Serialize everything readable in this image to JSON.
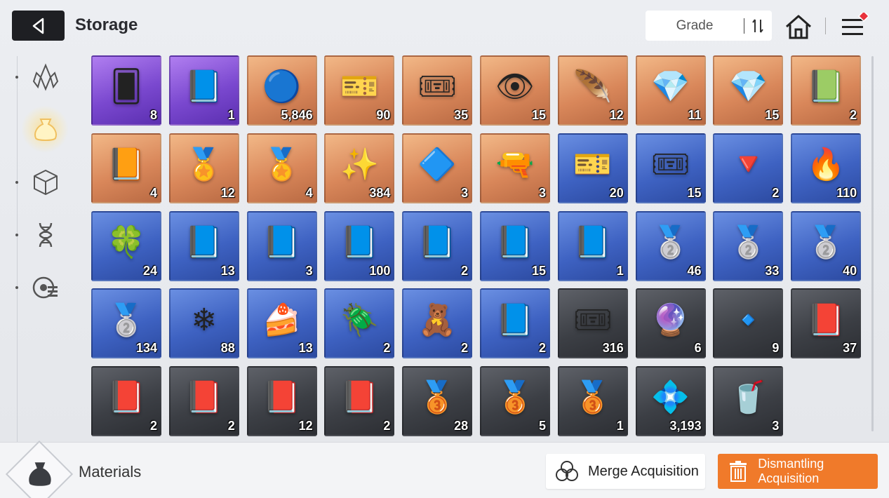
{
  "header": {
    "title": "Storage",
    "grade_label": "Grade"
  },
  "sidebar": {
    "items": [
      {
        "icon": "crystal-icon"
      },
      {
        "icon": "material-bag-icon",
        "active": true
      },
      {
        "icon": "cube-icon"
      },
      {
        "icon": "dna-icon"
      },
      {
        "icon": "target-list-icon"
      }
    ]
  },
  "items": [
    {
      "icon": "skill-card-icon",
      "glyph": "🂠",
      "grade": "purple",
      "count": "8"
    },
    {
      "icon": "manual-book-icon",
      "glyph": "📘",
      "grade": "purple",
      "count": "1"
    },
    {
      "icon": "eye-orb-icon",
      "glyph": "🔵",
      "grade": "orange",
      "count": "5,846"
    },
    {
      "icon": "gold-ticket-icon",
      "glyph": "🎫",
      "grade": "orange",
      "count": "90"
    },
    {
      "icon": "gold-ticket-1000-icon",
      "glyph": "🎟",
      "grade": "orange",
      "count": "35"
    },
    {
      "icon": "eye-crystal-icon",
      "glyph": "👁",
      "grade": "orange",
      "count": "15"
    },
    {
      "icon": "feather-icon",
      "glyph": "🪶",
      "grade": "orange",
      "count": "12"
    },
    {
      "icon": "orange-crystal-icon",
      "glyph": "💎",
      "grade": "orange",
      "count": "11"
    },
    {
      "icon": "green-crystal-icon",
      "glyph": "💎",
      "grade": "orange",
      "count": "15"
    },
    {
      "icon": "shield-book-icon",
      "glyph": "📗",
      "grade": "orange",
      "count": "2"
    },
    {
      "icon": "target-book-icon",
      "glyph": "📙",
      "grade": "orange",
      "count": "4"
    },
    {
      "icon": "shield-medal-icon",
      "glyph": "🏅",
      "grade": "orange",
      "count": "12"
    },
    {
      "icon": "target-medal-icon",
      "glyph": "🏅",
      "grade": "orange",
      "count": "4"
    },
    {
      "icon": "gold-shards-icon",
      "glyph": "✨",
      "grade": "orange",
      "count": "384"
    },
    {
      "icon": "blue-cube-icon",
      "glyph": "🔷",
      "grade": "orange",
      "count": "3"
    },
    {
      "icon": "spray-gun-icon",
      "glyph": "🔫",
      "grade": "orange",
      "count": "3"
    },
    {
      "icon": "blue-ticket-icon",
      "glyph": "🎫",
      "grade": "blue",
      "count": "20"
    },
    {
      "icon": "blue-ticket-300-icon",
      "glyph": "🎟",
      "grade": "blue",
      "count": "15"
    },
    {
      "icon": "red-crystal-icon",
      "glyph": "🔻",
      "grade": "blue",
      "count": "2"
    },
    {
      "icon": "fire-crystal-icon",
      "glyph": "🔥",
      "grade": "blue",
      "count": "110"
    },
    {
      "icon": "green-shard-icon",
      "glyph": "🍀",
      "grade": "blue",
      "count": "24"
    },
    {
      "icon": "sword-book-icon",
      "glyph": "📘",
      "grade": "blue",
      "count": "13"
    },
    {
      "icon": "shield-book-blue-icon",
      "glyph": "📘",
      "grade": "blue",
      "count": "3"
    },
    {
      "icon": "target-book-blue-icon",
      "glyph": "📘",
      "grade": "blue",
      "count": "100"
    },
    {
      "icon": "wing-book-icon",
      "glyph": "📘",
      "grade": "blue",
      "count": "2"
    },
    {
      "icon": "bolt-book-icon",
      "glyph": "📘",
      "grade": "blue",
      "count": "15"
    },
    {
      "icon": "orb-book-icon",
      "glyph": "📘",
      "grade": "blue",
      "count": "1"
    },
    {
      "icon": "target-medal-silver-icon",
      "glyph": "🥈",
      "grade": "blue",
      "count": "46"
    },
    {
      "icon": "sword-medal-silver-icon",
      "glyph": "🥈",
      "grade": "blue",
      "count": "33"
    },
    {
      "icon": "bolt-medal-silver-icon",
      "glyph": "🥈",
      "grade": "blue",
      "count": "40"
    },
    {
      "icon": "orb-medal-silver-icon",
      "glyph": "🥈",
      "grade": "blue",
      "count": "134"
    },
    {
      "icon": "ice-crystal-icon",
      "glyph": "❄",
      "grade": "blue",
      "count": "88"
    },
    {
      "icon": "cake-icon",
      "glyph": "🍰",
      "grade": "blue",
      "count": "13"
    },
    {
      "icon": "beetle-icon",
      "glyph": "🪲",
      "grade": "blue",
      "count": "2"
    },
    {
      "icon": "teddy-bear-icon",
      "glyph": "🧸",
      "grade": "blue",
      "count": "2"
    },
    {
      "icon": "manual-book-blue-icon",
      "glyph": "📘",
      "grade": "blue",
      "count": "2"
    },
    {
      "icon": "silver-ticket-icon",
      "glyph": "🎟",
      "grade": "gray",
      "count": "316"
    },
    {
      "icon": "purple-shard-icon",
      "glyph": "🔮",
      "grade": "gray",
      "count": "6"
    },
    {
      "icon": "blue-shard-icon",
      "glyph": "🔹",
      "grade": "gray",
      "count": "9"
    },
    {
      "icon": "sword-book-brown-icon",
      "glyph": "📕",
      "grade": "gray",
      "count": "37"
    },
    {
      "icon": "target-book-brown-icon",
      "glyph": "📕",
      "grade": "gray",
      "count": "2"
    },
    {
      "icon": "wing-book-brown-icon",
      "glyph": "📕",
      "grade": "gray",
      "count": "2"
    },
    {
      "icon": "bolt-book-brown-icon",
      "glyph": "📕",
      "grade": "gray",
      "count": "12"
    },
    {
      "icon": "orb-book-brown-icon",
      "glyph": "📕",
      "grade": "gray",
      "count": "2"
    },
    {
      "icon": "sword-medal-bronze-icon",
      "glyph": "🥉",
      "grade": "gray",
      "count": "28"
    },
    {
      "icon": "bolt-medal-bronze-icon",
      "glyph": "🥉",
      "grade": "gray",
      "count": "5"
    },
    {
      "icon": "orb-medal-bronze-icon",
      "glyph": "🥉",
      "grade": "gray",
      "count": "1"
    },
    {
      "icon": "crystal-cluster-icon",
      "glyph": "💠",
      "grade": "gray",
      "count": "3,193"
    },
    {
      "icon": "coffee-drink-icon",
      "glyph": "🥤",
      "grade": "gray",
      "count": "3"
    }
  ],
  "footer": {
    "category_label": "Materials",
    "merge_label": "Merge Acquisition",
    "dismantle_label": "Dismantling Acquisition"
  },
  "colors": {
    "accent_orange": "#f07a2a",
    "notification_red": "#e8323c"
  }
}
